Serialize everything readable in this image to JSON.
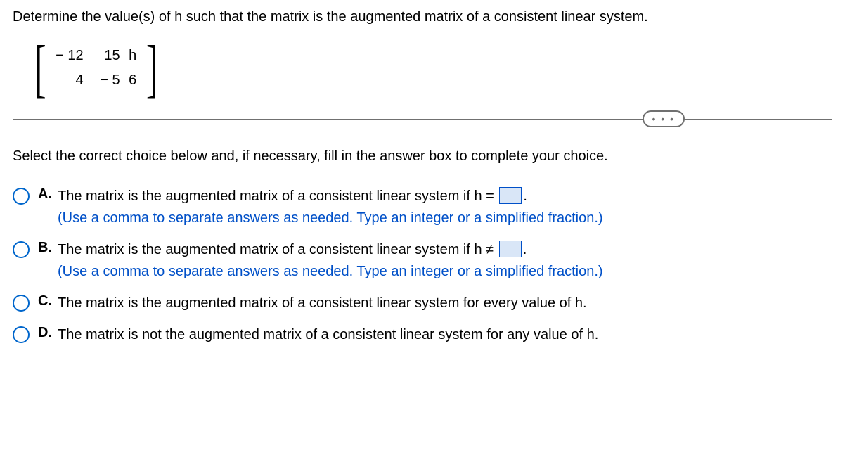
{
  "question": "Determine the value(s) of h such that the matrix is the augmented matrix of a consistent linear system.",
  "matrix": {
    "r1c1": "− 12",
    "r1c2": "15",
    "r1c3": "h",
    "r2c1": "4",
    "r2c2": "− 5",
    "r2c3": "6"
  },
  "selectIntro": "Select the correct choice below and, if necessary, fill in the answer box to complete your choice.",
  "choices": {
    "A": {
      "label": "A.",
      "text1": "The matrix is the augmented matrix of a consistent linear system if h =",
      "text2": ".",
      "hint": "(Use a comma to separate answers as needed. Type an integer or a simplified fraction.)"
    },
    "B": {
      "label": "B.",
      "text1": "The matrix is the augmented matrix of a consistent linear system if h ≠",
      "text2": ".",
      "hint": "(Use a comma to separate answers as needed. Type an integer or a simplified fraction.)"
    },
    "C": {
      "label": "C.",
      "text1": "The matrix is the augmented matrix of a consistent linear system for every value of h."
    },
    "D": {
      "label": "D.",
      "text1": "The matrix is not the augmented matrix of a consistent linear system for any value of h."
    }
  },
  "ellipsis": "• • •"
}
